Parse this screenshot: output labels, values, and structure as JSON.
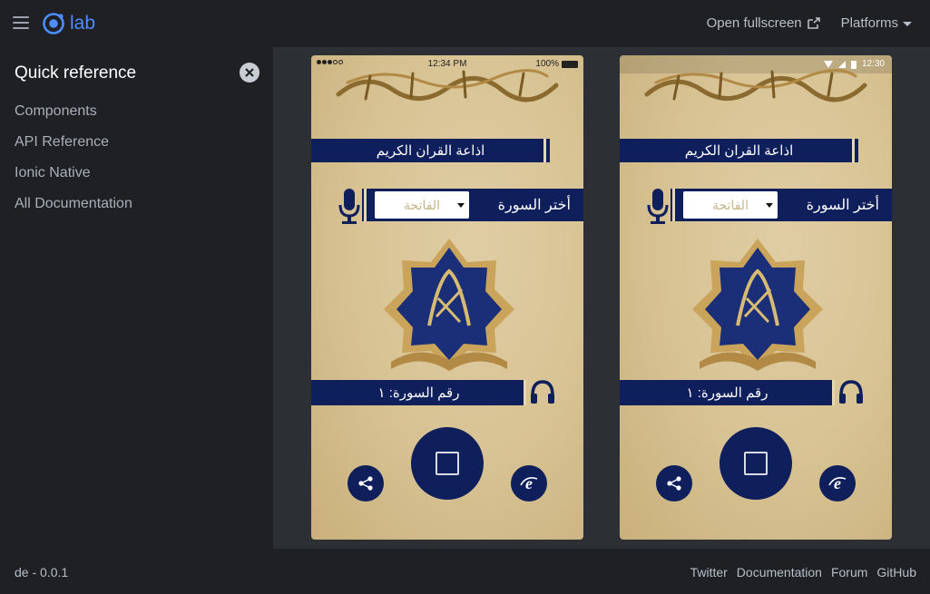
{
  "header": {
    "logo_text": "lab",
    "open_fullscreen": "Open fullscreen",
    "platforms": "Platforms"
  },
  "sidebar": {
    "title": "Quick reference",
    "items": [
      {
        "label": "Components"
      },
      {
        "label": "API Reference"
      },
      {
        "label": "Ionic Native"
      },
      {
        "label": "All Documentation"
      }
    ]
  },
  "phones": {
    "ios": {
      "time": "12:34 PM",
      "battery": "100%"
    },
    "android": {
      "time": "12:30"
    },
    "app": {
      "radio_title": "اذاعة القران الكريم",
      "select_label": "أختر السورة",
      "select_value": "الفاتحة",
      "surah_number": "رقم السورة: ١"
    }
  },
  "footer": {
    "version": "de - 0.0.1",
    "links": [
      "Twitter",
      "Documentation",
      "Forum",
      "GitHub"
    ]
  },
  "colors": {
    "ionic_blue": "#4d8dff",
    "app_navy": "#0f1f5c",
    "parchment": "#d8c394"
  }
}
